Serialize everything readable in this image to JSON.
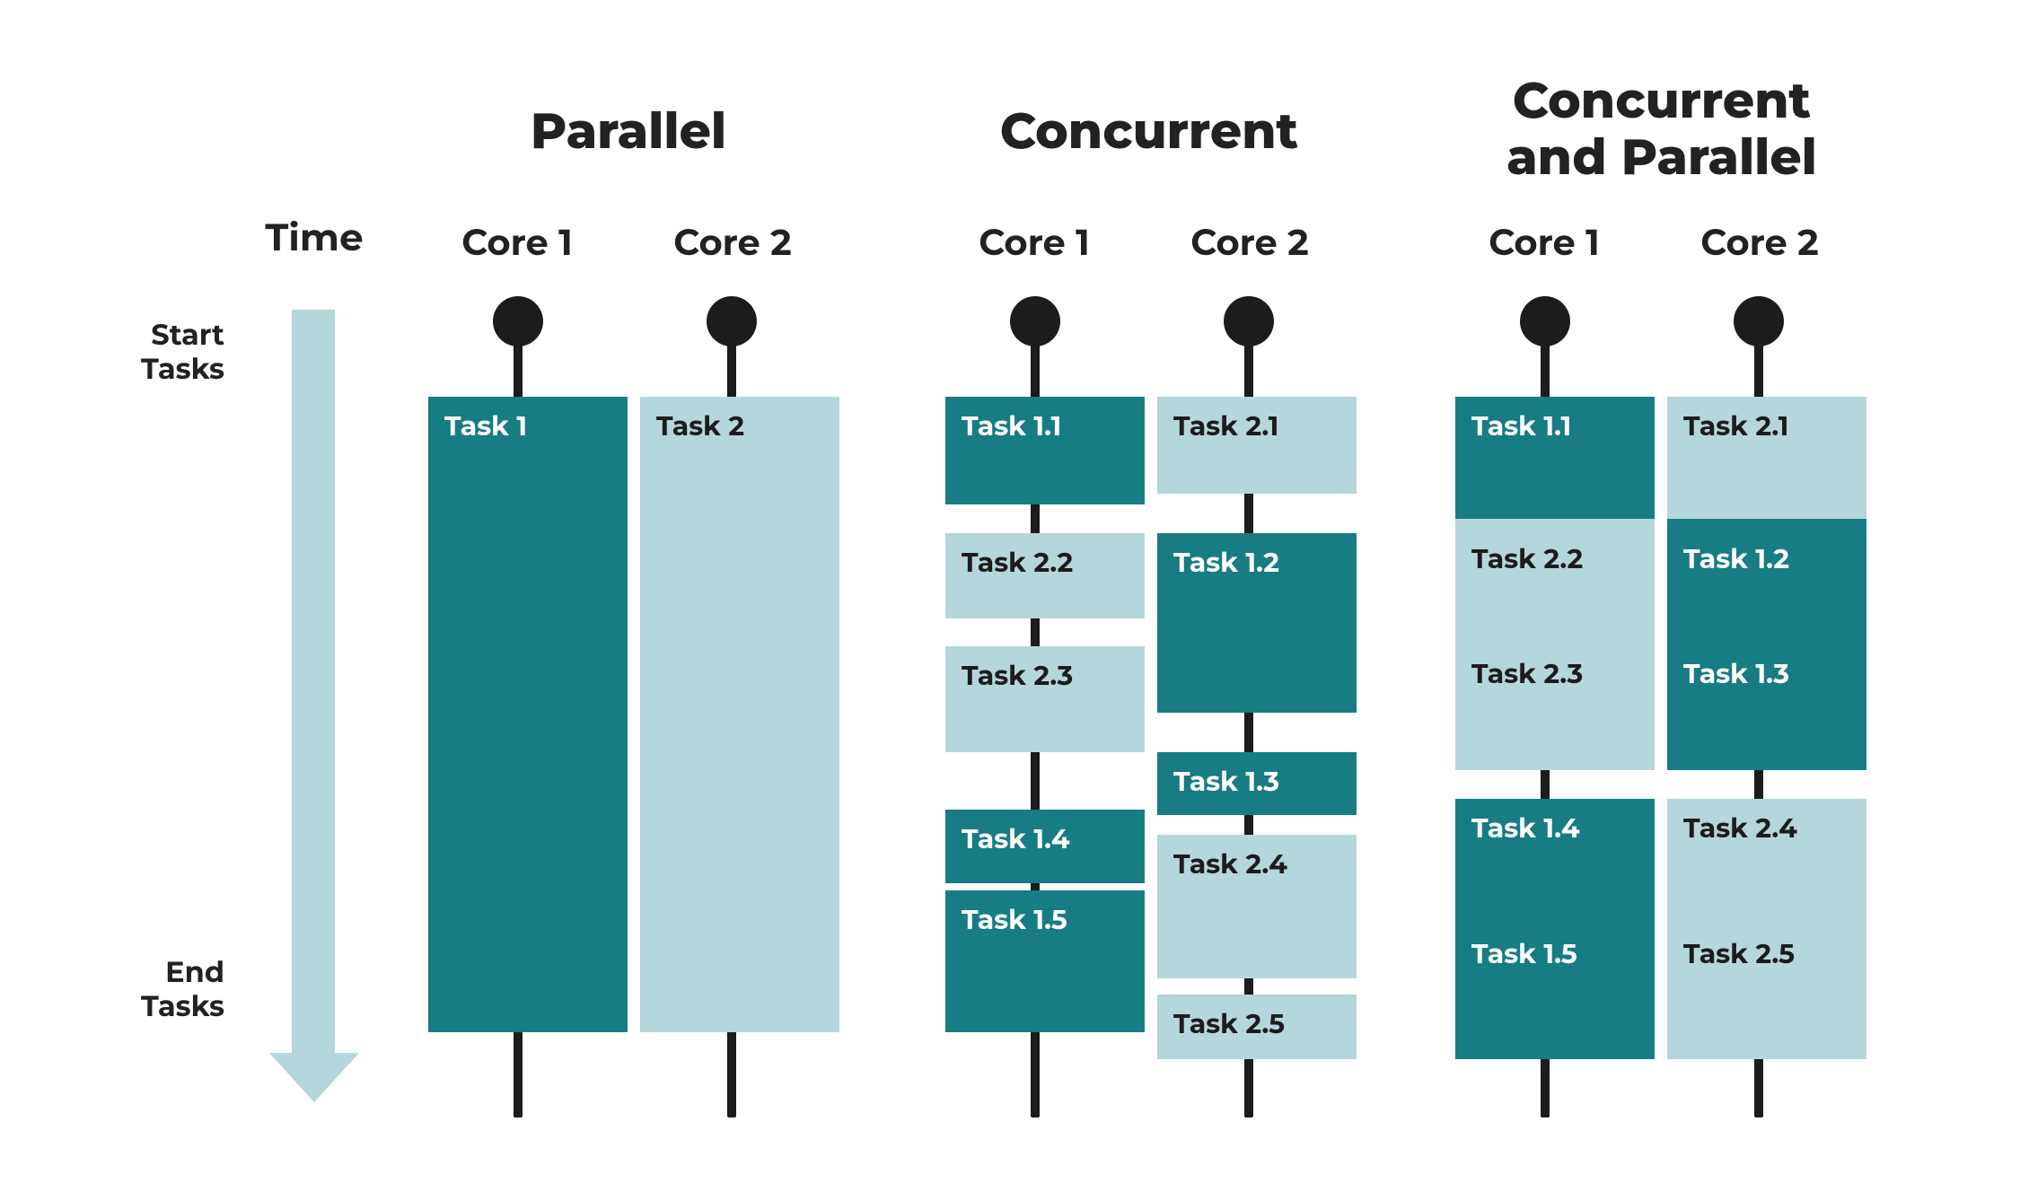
{
  "labels": {
    "time": "Time",
    "start": "Start\nTasks",
    "end": "End\nTasks"
  },
  "colors": {
    "dark": "#177c84",
    "light": "#b3d7da",
    "ink": "#1c1c1c"
  },
  "sections": [
    {
      "title": "Parallel",
      "cores": [
        "Core 1",
        "Core 2"
      ],
      "columns": [
        {
          "tasks": [
            {
              "label": "Task 1",
              "tone": "dark",
              "span": 1.0
            }
          ]
        },
        {
          "tasks": [
            {
              "label": "Task 2",
              "tone": "light",
              "span": 1.0
            }
          ]
        }
      ]
    },
    {
      "title": "Concurrent",
      "cores": [
        "Core 1",
        "Core 2"
      ],
      "columns": [
        {
          "tasks": [
            {
              "label": "Task 1.1",
              "tone": "dark"
            },
            {
              "label": "Task 2.2",
              "tone": "light"
            },
            {
              "label": "Task 2.3",
              "tone": "light"
            },
            {
              "label": "Task 1.4",
              "tone": "dark"
            },
            {
              "label": "Task 1.5",
              "tone": "dark"
            }
          ]
        },
        {
          "tasks": [
            {
              "label": "Task 2.1",
              "tone": "light"
            },
            {
              "label": "Task 1.2",
              "tone": "dark"
            },
            {
              "label": "Task 1.3",
              "tone": "dark"
            },
            {
              "label": "Task 2.4",
              "tone": "light"
            },
            {
              "label": "Task 2.5",
              "tone": "light"
            }
          ]
        }
      ]
    },
    {
      "title": "Concurrent\nand Parallel",
      "cores": [
        "Core 1",
        "Core 2"
      ],
      "columns": [
        {
          "tasks": [
            {
              "label": "Task 1.1",
              "tone": "dark"
            },
            {
              "label": "Task 2.2",
              "tone": "light"
            },
            {
              "label": "Task 2.3",
              "tone": "light"
            },
            {
              "label": "Task 1.4",
              "tone": "dark"
            },
            {
              "label": "Task 1.5",
              "tone": "dark"
            }
          ]
        },
        {
          "tasks": [
            {
              "label": "Task 2.1",
              "tone": "light"
            },
            {
              "label": "Task 1.2",
              "tone": "dark"
            },
            {
              "label": "Task 1.3",
              "tone": "dark"
            },
            {
              "label": "Task 2.4",
              "tone": "light"
            },
            {
              "label": "Task 2.5",
              "tone": "light"
            }
          ]
        }
      ]
    }
  ]
}
